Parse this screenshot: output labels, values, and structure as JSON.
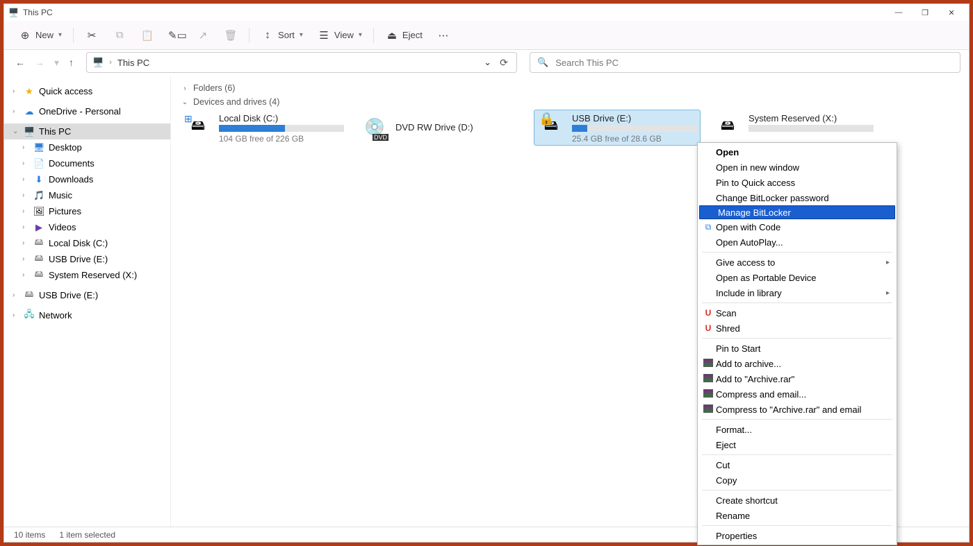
{
  "window": {
    "title": "This PC"
  },
  "toolbar": {
    "new": "New",
    "sort": "Sort",
    "view": "View",
    "eject": "Eject"
  },
  "address": {
    "crumb": "This PC",
    "search_placeholder": "Search This PC"
  },
  "tree": {
    "quick_access": "Quick access",
    "onedrive": "OneDrive - Personal",
    "this_pc": "This PC",
    "desktop": "Desktop",
    "documents": "Documents",
    "downloads": "Downloads",
    "music": "Music",
    "pictures": "Pictures",
    "videos": "Videos",
    "local_disk": "Local Disk (C:)",
    "usb_e": "USB Drive (E:)",
    "system_reserved": "System Reserved (X:)",
    "usb_e_root": "USB Drive (E:)",
    "network": "Network"
  },
  "groups": {
    "folders": "Folders (6)",
    "devices": "Devices and drives (4)"
  },
  "drives": {
    "c": {
      "name": "Local Disk (C:)",
      "free": "104 GB free of 226 GB",
      "fill": "53%"
    },
    "d": {
      "name": "DVD RW Drive (D:)"
    },
    "e": {
      "name": "USB Drive (E:)",
      "free": "25.4 GB free of 28.6 GB",
      "fill": "12%"
    },
    "x": {
      "name": "System Reserved (X:)",
      "fill": "0%"
    }
  },
  "context": {
    "open": "Open",
    "open_new": "Open in new window",
    "pin_qa": "Pin to Quick access",
    "change_bl": "Change BitLocker password",
    "manage_bl": "Manage BitLocker",
    "open_code": "Open with Code",
    "autoplay": "Open AutoPlay...",
    "give_access": "Give access to",
    "portable": "Open as Portable Device",
    "include_lib": "Include in library",
    "scan": "Scan",
    "shred": "Shred",
    "pin_start": "Pin to Start",
    "add_archive": "Add to archive...",
    "add_rar": "Add to \"Archive.rar\"",
    "compress_email": "Compress and email...",
    "compress_rar_email": "Compress to \"Archive.rar\" and email",
    "format": "Format...",
    "eject": "Eject",
    "cut": "Cut",
    "copy": "Copy",
    "shortcut": "Create shortcut",
    "rename": "Rename",
    "properties": "Properties"
  },
  "status": {
    "items": "10 items",
    "selected": "1 item selected"
  }
}
